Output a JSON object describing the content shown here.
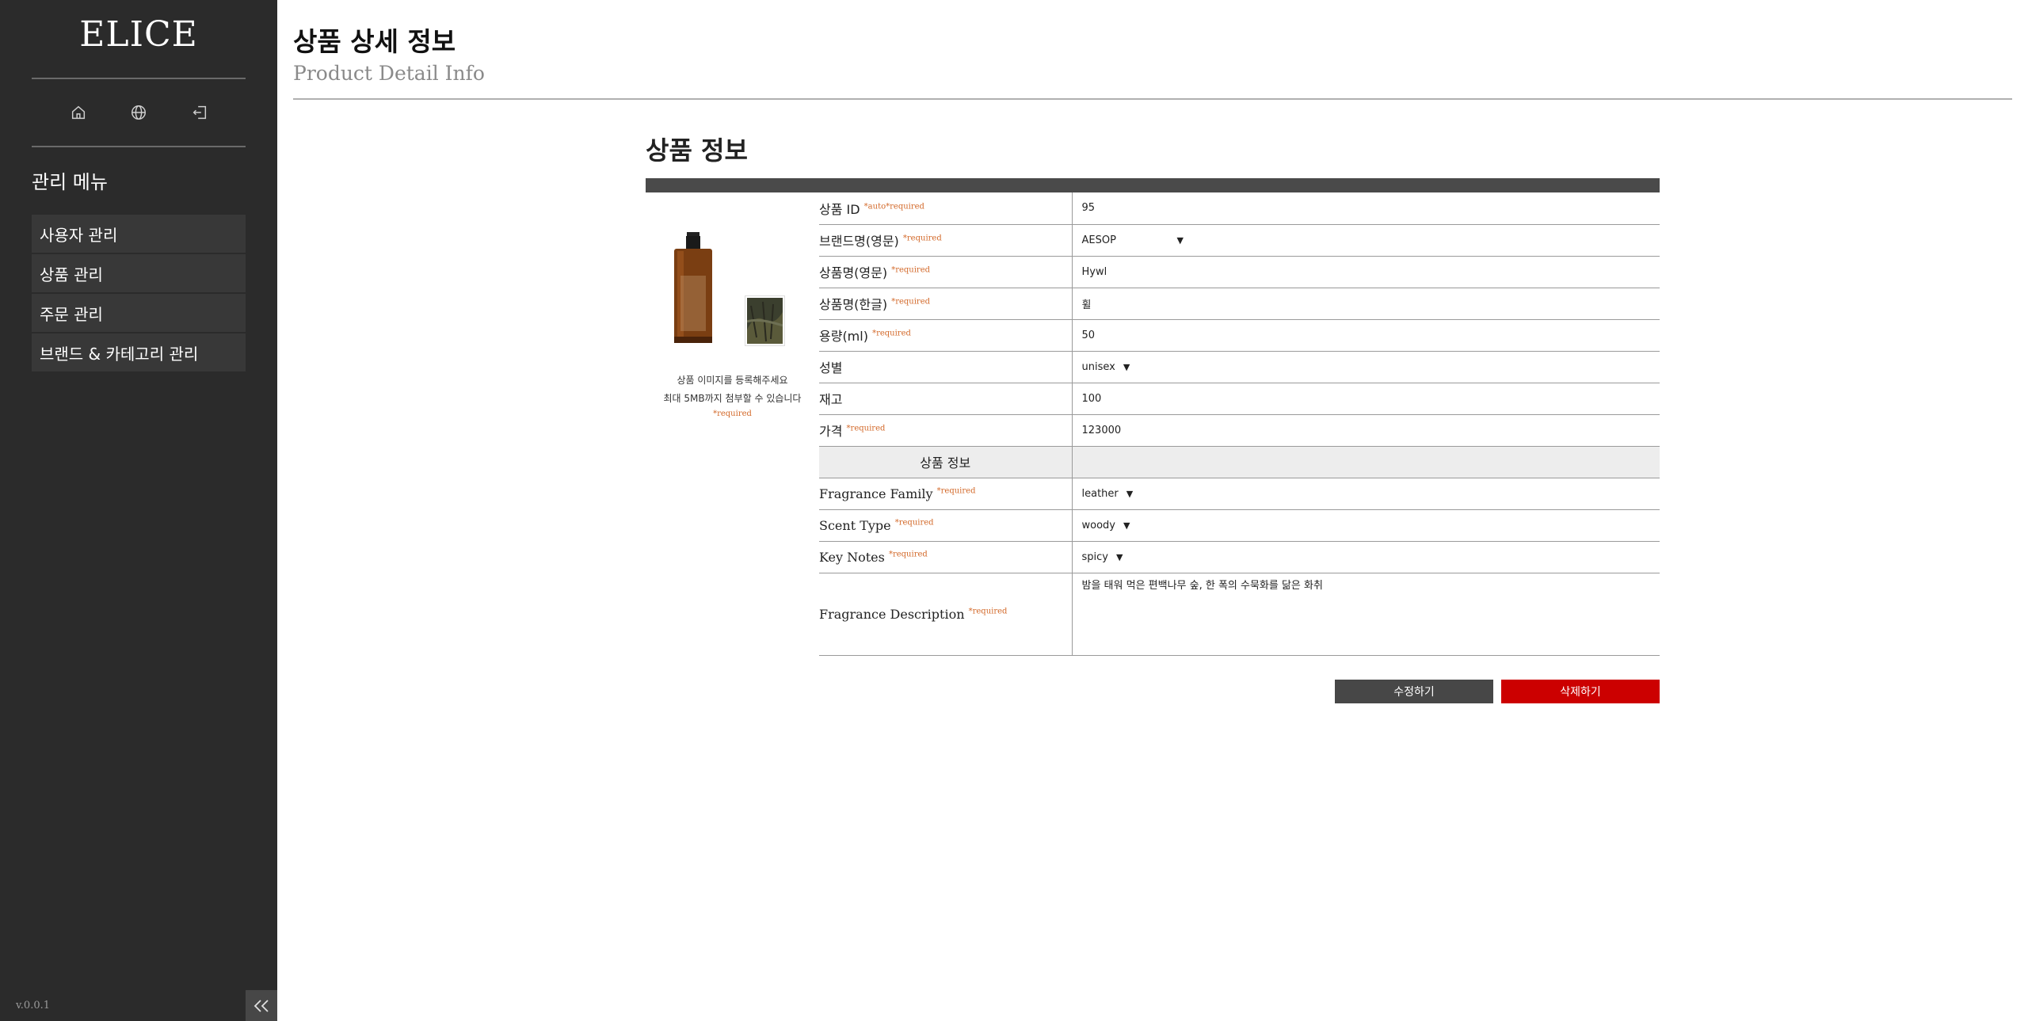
{
  "sidebar": {
    "logo": "ELICE",
    "icons": [
      "home-icon",
      "globe-icon",
      "logout-icon"
    ],
    "menu_title": "관리 메뉴",
    "items": [
      {
        "label": "사용자 관리"
      },
      {
        "label": "상품 관리"
      },
      {
        "label": "주문 관리"
      },
      {
        "label": "브랜드 & 카테고리 관리"
      }
    ],
    "version": "v.0.0.1"
  },
  "header": {
    "title": "상품 상세 정보",
    "subtitle": "Product Detail Info"
  },
  "section": {
    "title": "상품 정보"
  },
  "image_area": {
    "upload_line1": "상품 이미지를 등록해주세요",
    "upload_line2": "최대 5MB까지 첨부할 수 있습니다",
    "required": "*required"
  },
  "form": {
    "required_mark": "*required",
    "auto_mark": "*auto",
    "product_id": {
      "label": "상품 ID",
      "value": "95"
    },
    "brand": {
      "label": "브랜드명(영문)",
      "value": "AESOP"
    },
    "name_en": {
      "label": "상품명(영문)",
      "value": "Hywl"
    },
    "name_ko": {
      "label": "상품명(한글)",
      "value": "휠"
    },
    "volume": {
      "label": "용량(ml)",
      "value": "50"
    },
    "gender": {
      "label": "성별",
      "value": "unisex"
    },
    "stock": {
      "label": "재고",
      "value": "100"
    },
    "price": {
      "label": "가격",
      "value": "123000"
    },
    "subheader": "상품 정보",
    "fragrance_family": {
      "label": "Fragrance Family",
      "value": "leather"
    },
    "scent_type": {
      "label": "Scent Type",
      "value": "woody"
    },
    "key_notes": {
      "label": "Key Notes",
      "value": "spicy"
    },
    "description": {
      "label": "Fragrance Description",
      "value": "밤을 태워 먹은 편백나무 숲, 한 폭의 수묵화를 닮은 화취"
    }
  },
  "buttons": {
    "edit": "수정하기",
    "delete": "삭제하기"
  },
  "colors": {
    "sidebar_bg": "#2b2b2b",
    "required": "#d36a2b",
    "delete": "#cc0000",
    "edit": "#474747"
  }
}
